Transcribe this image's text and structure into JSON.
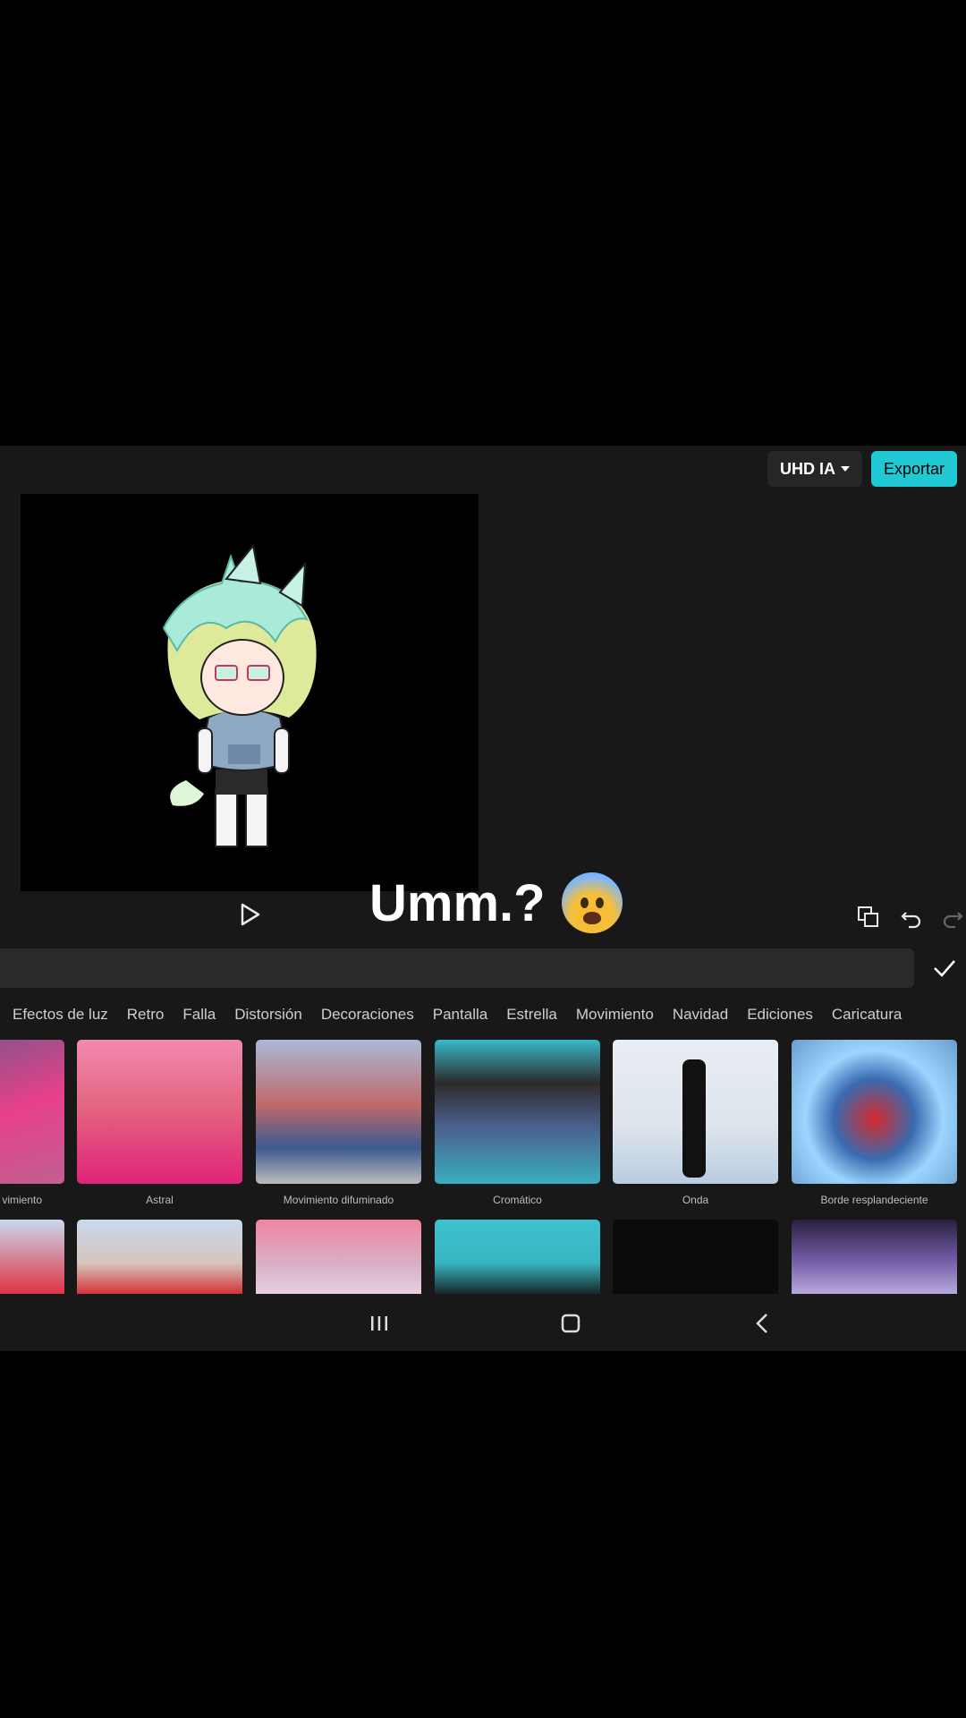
{
  "topbar": {
    "quality_label": "UHD IA",
    "export_label": "Exportar"
  },
  "caption": "Umm.?",
  "categories": [
    "Efectos de luz",
    "Retro",
    "Falla",
    "Distorsión",
    "Decoraciones",
    "Pantalla",
    "Estrella",
    "Movimiento",
    "Navidad",
    "Ediciones",
    "Caricatura"
  ],
  "effects_row1": [
    "vimiento",
    "Astral",
    "Movimiento difuminado",
    "Cromático",
    "Onda",
    "Borde resplandeciente"
  ],
  "icons": {
    "play": "play-icon",
    "toggle": "toggle-off-icon",
    "undo": "undo-icon",
    "redo": "redo-icon",
    "check": "check-icon",
    "recent": "recent-apps-icon",
    "home": "home-icon",
    "back": "back-icon"
  },
  "colors": {
    "accent": "#20c9d4",
    "background": "#181818"
  }
}
